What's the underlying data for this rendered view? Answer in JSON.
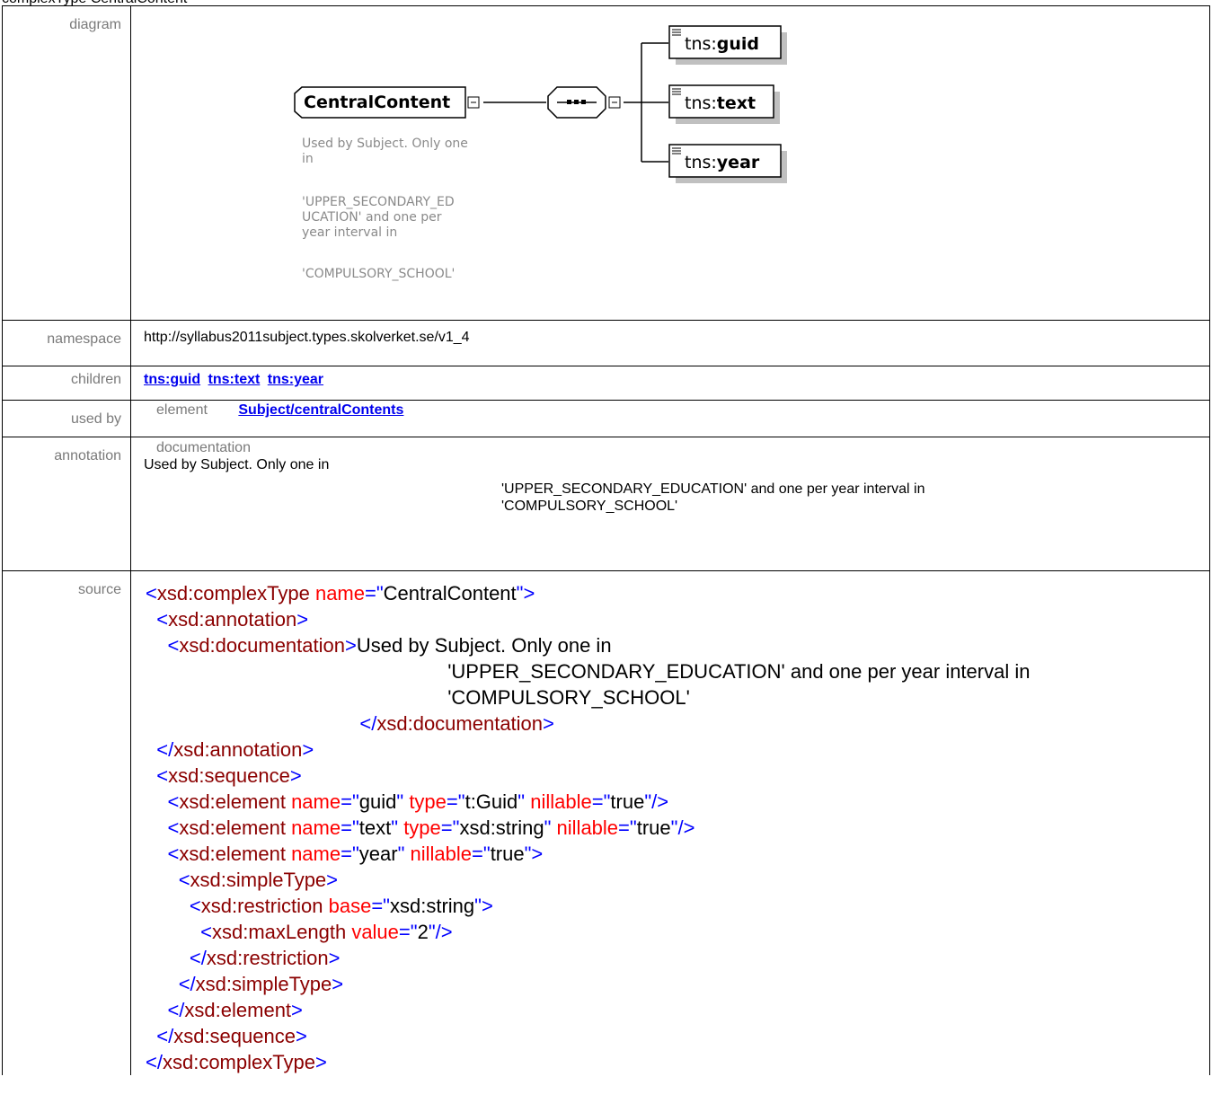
{
  "page": {
    "title": "complexType CentralContent"
  },
  "labels": {
    "diagram": "diagram",
    "namespace": "namespace",
    "children": "children",
    "used_by": "used by",
    "annotation": "annotation",
    "source": "source"
  },
  "diagram": {
    "root": "CentralContent",
    "root_doc": [
      "Used by Subject. Only one",
      "in",
      "'UPPER_SECONDARY_ED",
      "UCATION' and one per",
      "year interval in",
      "'COMPULSORY_SCHOOL'"
    ],
    "children": [
      {
        "prefix": "tns:",
        "name": "guid"
      },
      {
        "prefix": "tns:",
        "name": "text"
      },
      {
        "prefix": "tns:",
        "name": "year"
      }
    ]
  },
  "namespace": "http://syllabus2011subject.types.skolverket.se/v1_4",
  "children": [
    "tns:guid",
    "tns:text",
    "tns:year"
  ],
  "used_by": {
    "kind": "element",
    "link": "Subject/centralContents"
  },
  "annotation": {
    "label": "documentation",
    "line1": "Used by Subject. Only one in",
    "line2": "'UPPER_SECONDARY_EDUCATION' and one per year interval in",
    "line3": "'COMPULSORY_SCHOOL'"
  },
  "source": {
    "l1": {
      "tag": "xsd:complexType",
      "a1": "name",
      "v1": "CentralContent"
    },
    "l2": "xsd:annotation",
    "l3": {
      "tag": "xsd:documentation",
      "text": "Used by Subject. Only one in"
    },
    "l4": "'UPPER_SECONDARY_EDUCATION' and one per year interval in",
    "l5": "'COMPULSORY_SCHOOL'",
    "l6": "xsd:documentation",
    "l7": "xsd:annotation",
    "l8": "xsd:sequence",
    "l9": {
      "tag": "xsd:element",
      "a1": "name",
      "v1": "guid",
      "a2": "type",
      "v2": "t:Guid",
      "a3": "nillable",
      "v3": "true"
    },
    "l10": {
      "tag": "xsd:element",
      "a1": "name",
      "v1": "text",
      "a2": "type",
      "v2": "xsd:string",
      "a3": "nillable",
      "v3": "true"
    },
    "l11": {
      "tag": "xsd:element",
      "a1": "name",
      "v1": "year",
      "a2": "nillable",
      "v2": "true"
    },
    "l12": "xsd:simpleType",
    "l13": {
      "tag": "xsd:restriction",
      "a1": "base",
      "v1": "xsd:string"
    },
    "l14": {
      "tag": "xsd:maxLength",
      "a1": "value",
      "v1": "2"
    },
    "l15": "xsd:restriction",
    "l16": "xsd:simpleType",
    "l17": "xsd:element",
    "l18": "xsd:sequence",
    "l19": "xsd:complexType"
  }
}
